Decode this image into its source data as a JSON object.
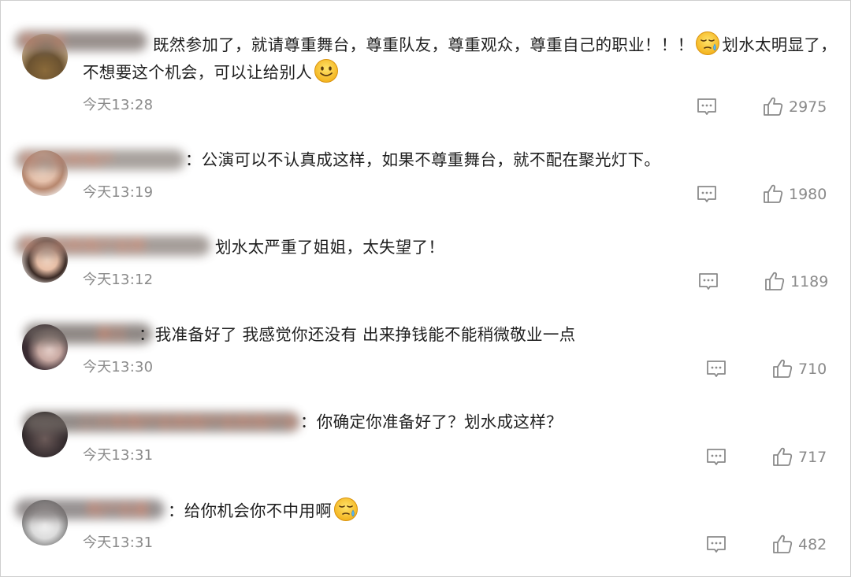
{
  "comments": [
    {
      "user": "用户名",
      "text_line1": "既然参加了，就请尊重舞台，尊重队友，尊重观众，尊重自己的职业！！！",
      "text_line1_tail": "划水太明显了，",
      "text_line2": "不想要这个机会，可以让给别人",
      "time": "今天13:28",
      "likes": "2975",
      "emoji1": "sweat-smile-emoji",
      "emoji2": "smile-emoji"
    },
    {
      "user": "用户名称用户",
      "text": "：公演可以不认真成这样，如果不尊重舞台，就不配在聚光灯下。",
      "time": "今天13:19",
      "likes": "1980"
    },
    {
      "user": "用户名称用户名称",
      "text": "划水太严重了姐姐，太失望了！",
      "time": "今天13:12",
      "likes": "1189"
    },
    {
      "user": "演江",
      "text": "：我准备好了 我感觉你还没有 出来挣钱能不能稍微敬业一点",
      "time": "今天13:30",
      "likes": "710"
    },
    {
      "user": "二十年用户名称用户名称用户名",
      "text": "：你确定你准备好了？划水成这样？",
      "time": "今天13:31",
      "likes": "717"
    },
    {
      "user": "用户名酱",
      "text": "：给你机会你不中用啊",
      "time": "今天13:31",
      "likes": "482",
      "emoji": "sweat-emoji"
    }
  ],
  "colors": {
    "text": "#1f1f1f",
    "meta": "#8a8a8a",
    "username": "#eb7350",
    "border": "#cfcfcf"
  },
  "icons": {
    "reply": "comment-reply-icon",
    "like": "thumbs-up-icon"
  }
}
